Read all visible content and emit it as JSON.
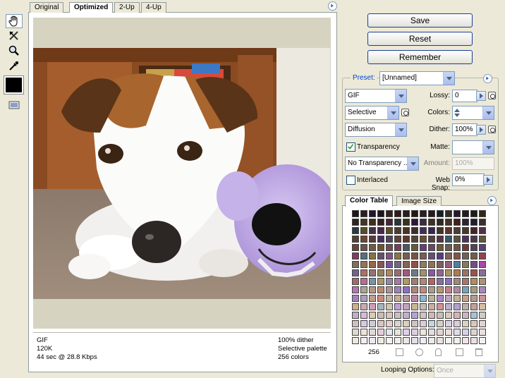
{
  "tabs": [
    {
      "label": "Original"
    },
    {
      "label": "Optimized"
    },
    {
      "label": "2-Up"
    },
    {
      "label": "4-Up"
    }
  ],
  "tools": [
    "hand-icon",
    "slice-select-icon",
    "zoom-icon",
    "eyedropper-icon",
    "eyedropper-color-icon",
    "toggle-slices-icon"
  ],
  "preview": {
    "info_left": [
      "GIF",
      "120K",
      "44 sec @ 28.8 Kbps"
    ],
    "info_right": [
      "100% dither",
      "Selective palette",
      "256 colors"
    ]
  },
  "buttons": {
    "save": "Save",
    "reset": "Reset",
    "remember": "Remember"
  },
  "settings": {
    "preset_label": "Preset:",
    "preset_value": "[Unnamed]",
    "format": "GIF",
    "lossy_label": "Lossy:",
    "lossy_value": "0",
    "reduction": "Selective",
    "colors_label": "Colors:",
    "colors_value": "",
    "dither_algo": "Diffusion",
    "dither_label": "Dither:",
    "dither_value": "100%",
    "transparency_label": "Transparency",
    "transparency_checked": true,
    "matte_label": "Matte:",
    "transparency_dither": "No Transparency ...",
    "amount_label": "Amount:",
    "amount_value": "100%",
    "interlaced_label": "Interlaced",
    "interlaced_checked": false,
    "websnap_label": "Web Snap:",
    "websnap_value": "0%"
  },
  "color_table": {
    "tabs": [
      "Color Table",
      "Image Size"
    ],
    "count": "256",
    "footer_icons": [
      "web-shift-icon",
      "lock-color-icon",
      "lock-icon",
      "new-color-icon",
      "trash-icon"
    ]
  },
  "looping": {
    "label": "Looping Options:",
    "value": "Once"
  }
}
